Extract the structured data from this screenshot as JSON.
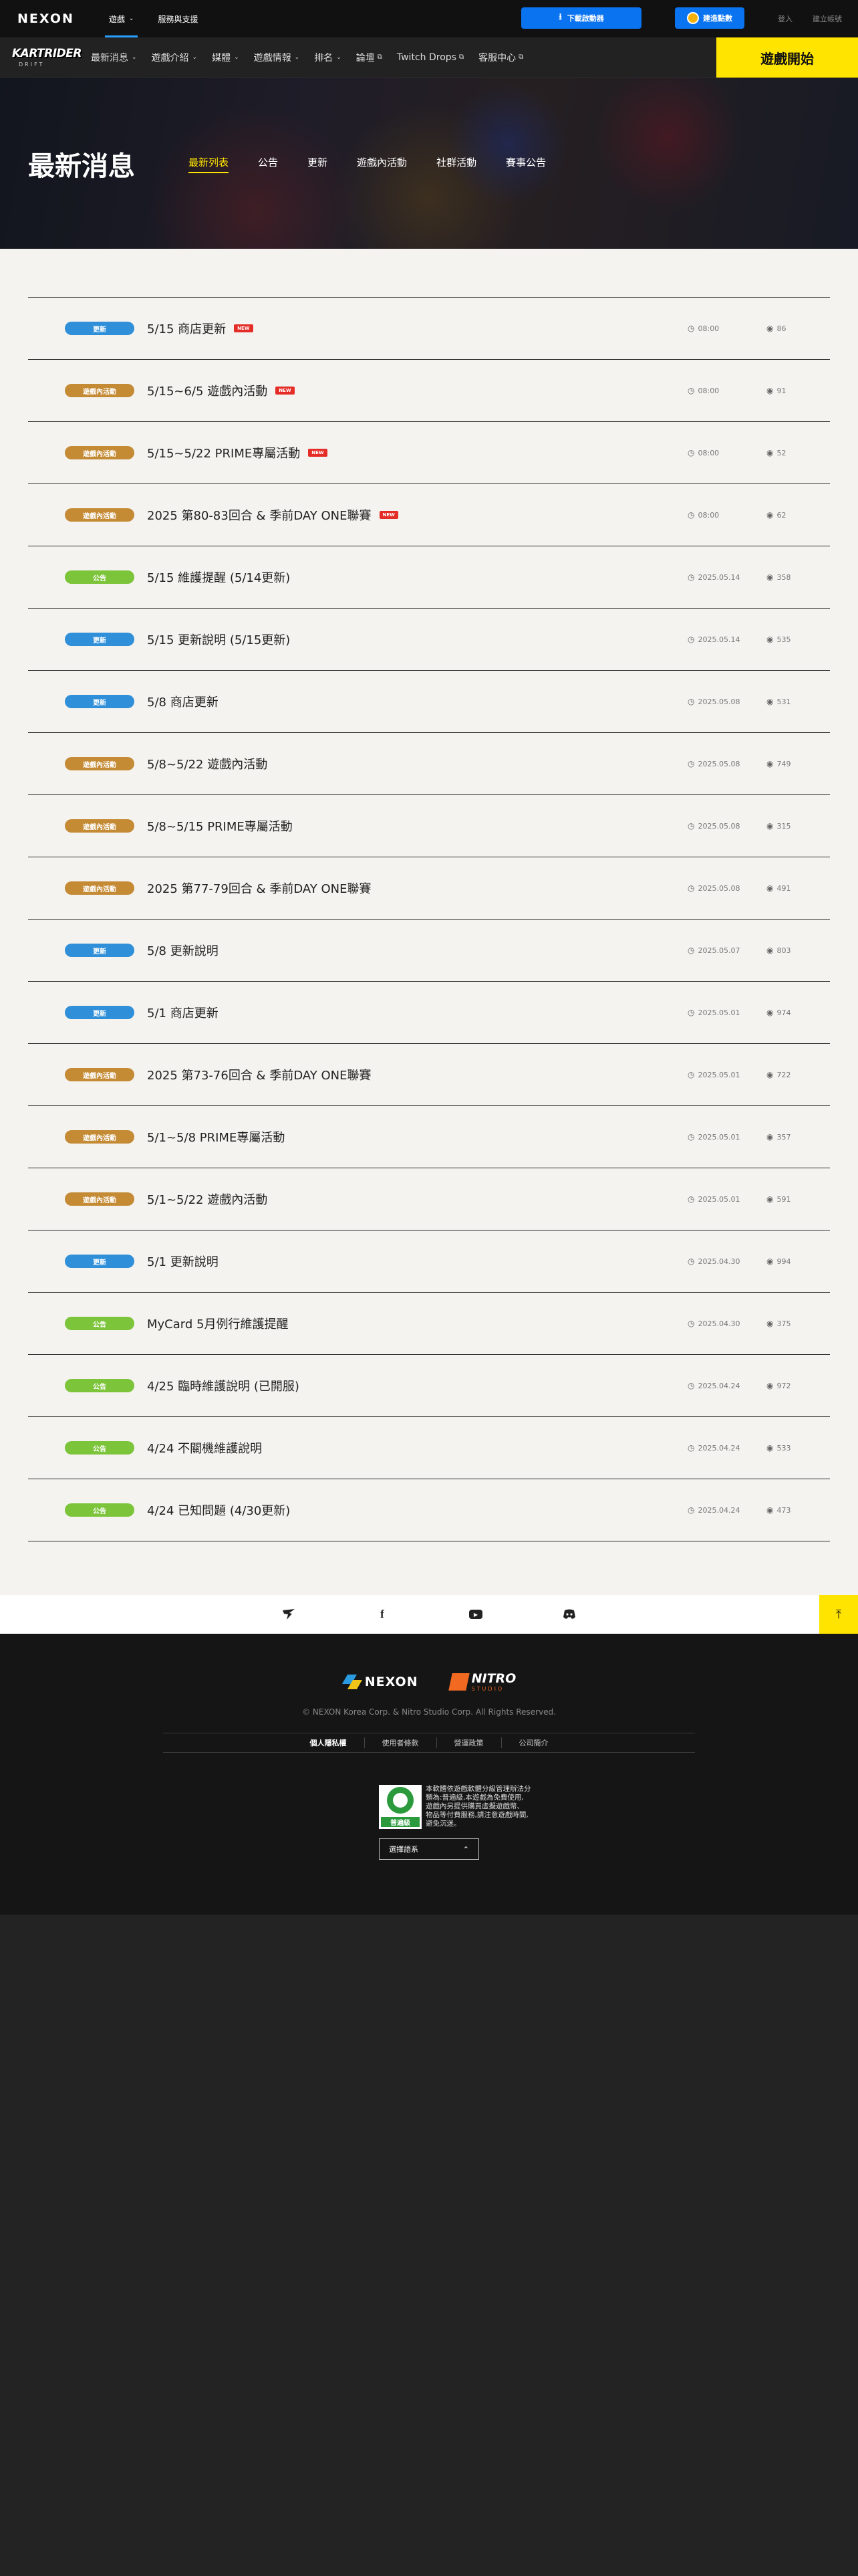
{
  "topbar": {
    "logo": "NEXON",
    "games_label": "遊戲",
    "support_label": "服務與支援",
    "download_label": "下載啟動器",
    "beanfun_label": "建造點數",
    "login_label": "登入",
    "signup_label": "建立帳號"
  },
  "gamenav": {
    "logo_text": "KARTRIDER",
    "logo_sub": "DRIFT",
    "items": [
      {
        "label": "最新消息",
        "suffix": "chevron"
      },
      {
        "label": "遊戲介紹",
        "suffix": "chevron"
      },
      {
        "label": "媒體",
        "suffix": "chevron"
      },
      {
        "label": "遊戲情報",
        "suffix": "chevron"
      },
      {
        "label": "排名",
        "suffix": "chevron"
      },
      {
        "label": "論壇",
        "suffix": "external"
      },
      {
        "label": "Twitch Drops",
        "suffix": "external"
      },
      {
        "label": "客服中心",
        "suffix": "external"
      }
    ],
    "start_label": "遊戲開始"
  },
  "hero": {
    "title": "最新消息",
    "tabs": [
      "最新列表",
      "公告",
      "更新",
      "遊戲內活動",
      "社群活動",
      "賽事公告"
    ],
    "active_tab": 0
  },
  "category_colors": {
    "更新": "#2f8fd8",
    "遊戲內活動": "#c48a34",
    "公告": "#7cc43a"
  },
  "news": [
    {
      "category": "更新",
      "title": "5/15 商店更新",
      "is_new": true,
      "date": "08:00",
      "views": "86"
    },
    {
      "category": "遊戲內活動",
      "title": "5/15~6/5 遊戲內活動",
      "is_new": true,
      "date": "08:00",
      "views": "91"
    },
    {
      "category": "遊戲內活動",
      "title": "5/15~5/22 PRIME專屬活動",
      "is_new": true,
      "date": "08:00",
      "views": "52"
    },
    {
      "category": "遊戲內活動",
      "title": "2025 第80-83回合 & 季前DAY ONE聯賽",
      "is_new": true,
      "date": "08:00",
      "views": "62"
    },
    {
      "category": "公告",
      "title": "5/15 維護提醒 (5/14更新)",
      "is_new": false,
      "date": "2025.05.14",
      "views": "358"
    },
    {
      "category": "更新",
      "title": "5/15 更新說明 (5/15更新)",
      "is_new": false,
      "date": "2025.05.14",
      "views": "535"
    },
    {
      "category": "更新",
      "title": "5/8 商店更新",
      "is_new": false,
      "date": "2025.05.08",
      "views": "531"
    },
    {
      "category": "遊戲內活動",
      "title": "5/8~5/22 遊戲內活動",
      "is_new": false,
      "date": "2025.05.08",
      "views": "749"
    },
    {
      "category": "遊戲內活動",
      "title": "5/8~5/15 PRIME專屬活動",
      "is_new": false,
      "date": "2025.05.08",
      "views": "315"
    },
    {
      "category": "遊戲內活動",
      "title": "2025 第77-79回合 & 季前DAY ONE聯賽",
      "is_new": false,
      "date": "2025.05.08",
      "views": "491"
    },
    {
      "category": "更新",
      "title": "5/8 更新說明",
      "is_new": false,
      "date": "2025.05.07",
      "views": "803"
    },
    {
      "category": "更新",
      "title": "5/1 商店更新",
      "is_new": false,
      "date": "2025.05.01",
      "views": "974"
    },
    {
      "category": "遊戲內活動",
      "title": "2025 第73-76回合 & 季前DAY ONE聯賽",
      "is_new": false,
      "date": "2025.05.01",
      "views": "722"
    },
    {
      "category": "遊戲內活動",
      "title": "5/1~5/8 PRIME專屬活動",
      "is_new": false,
      "date": "2025.05.01",
      "views": "357"
    },
    {
      "category": "遊戲內活動",
      "title": "5/1~5/22 遊戲內活動",
      "is_new": false,
      "date": "2025.05.01",
      "views": "591"
    },
    {
      "category": "更新",
      "title": "5/1 更新說明",
      "is_new": false,
      "date": "2025.04.30",
      "views": "994"
    },
    {
      "category": "公告",
      "title": "MyCard 5月例行維護提醒",
      "is_new": false,
      "date": "2025.04.30",
      "views": "375"
    },
    {
      "category": "公告",
      "title": "4/25 臨時維護說明 (已開服)",
      "is_new": false,
      "date": "2025.04.24",
      "views": "972"
    },
    {
      "category": "公告",
      "title": "4/24 不關機維護說明",
      "is_new": false,
      "date": "2025.04.24",
      "views": "533"
    },
    {
      "category": "公告",
      "title": "4/24 已知問題 (4/30更新)",
      "is_new": false,
      "date": "2025.04.24",
      "views": "473"
    }
  ],
  "new_tag_label": "NEW",
  "social": [
    "kartrider-icon",
    "facebook-icon",
    "youtube-icon",
    "discord-icon"
  ],
  "footer": {
    "nexon_word": "NEXON",
    "nitro_word": "NITRO",
    "nitro_sub": "STUDIO",
    "copyright": "© NEXON Korea Corp. & Nitro Studio Corp. All Rights Reserved.",
    "links": [
      "個人隱私權",
      "使用者條款",
      "營運政策",
      "公司簡介"
    ],
    "rating_label": "普遍級",
    "rating_lines": [
      "本軟體依遊戲軟體分級管理辦法分",
      "類為:普遍級,本遊戲為免費使用,",
      "遊戲內另提供購買虛擬遊戲幣、",
      "物品等付費服務,請注意遊戲時間,",
      "避免沉迷。"
    ],
    "region_label": "選擇語系"
  }
}
